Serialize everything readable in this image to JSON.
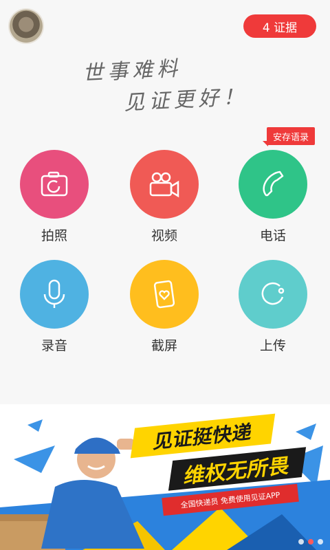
{
  "header": {
    "evidence_button_label": "4 证据"
  },
  "slogan": {
    "line1": "世事难料",
    "line2": "见证更好！"
  },
  "tag_label": "安存语录",
  "actions": [
    {
      "label": "拍照",
      "color": "#e84f7d",
      "icon": "camera-icon"
    },
    {
      "label": "视频",
      "color": "#f05a55",
      "icon": "video-camera-icon"
    },
    {
      "label": "电话",
      "color": "#2fc488",
      "icon": "phone-icon"
    },
    {
      "label": "录音",
      "color": "#4fb2e2",
      "icon": "microphone-icon"
    },
    {
      "label": "截屏",
      "color": "#ffbe1e",
      "icon": "screenshot-heart-icon"
    },
    {
      "label": "上传",
      "color": "#5fcdcc",
      "icon": "upload-icon"
    }
  ],
  "banner": {
    "title1": "见证挺快递",
    "title2": "维权无所畏",
    "subtitle": "全国快递员 免费使用见证APP"
  }
}
